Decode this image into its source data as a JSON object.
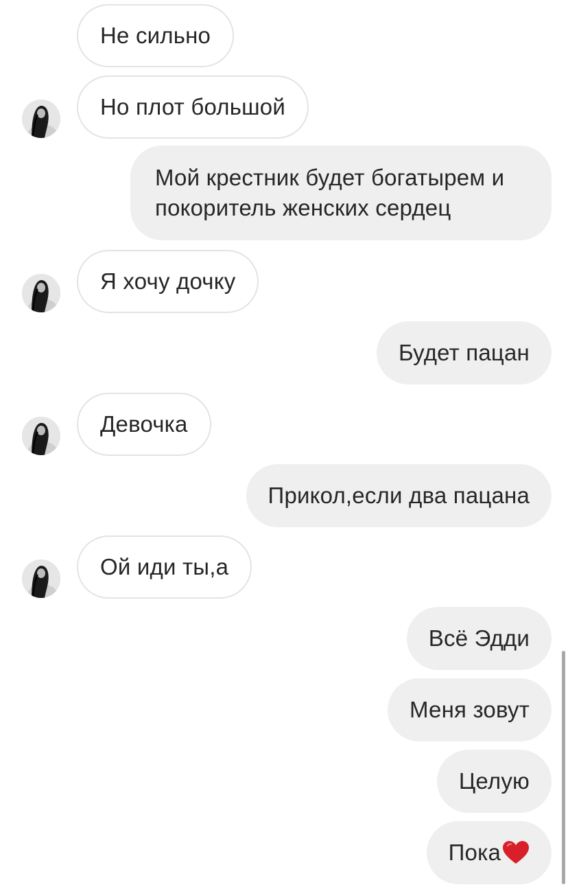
{
  "messages": [
    {
      "side": "in",
      "text": "Не сильно",
      "avatar": false
    },
    {
      "side": "in",
      "text": "Но плот большой",
      "avatar": true
    },
    {
      "side": "out",
      "text": "Мой крестник будет богатырем и покоритель женских сердец"
    },
    {
      "side": "in",
      "text": "Я хочу дочку",
      "avatar": true
    },
    {
      "side": "out",
      "text": "Будет пацан"
    },
    {
      "side": "in",
      "text": "Девочка",
      "avatar": true
    },
    {
      "side": "out",
      "text": "Прикол,если два пацана"
    },
    {
      "side": "in",
      "text": "Ой иди ты,а",
      "avatar": true
    },
    {
      "side": "out",
      "text": "Всё Эдди"
    },
    {
      "side": "out",
      "text": "Меня зовут"
    },
    {
      "side": "out",
      "text": "Целую"
    },
    {
      "side": "out",
      "text": "Пока",
      "emoji": "red-heart"
    }
  ],
  "colors": {
    "incoming_bg": "#ffffff",
    "incoming_border": "#e3e3e3",
    "outgoing_bg": "#efefef",
    "text": "#262626",
    "heart": "#d9202a"
  }
}
